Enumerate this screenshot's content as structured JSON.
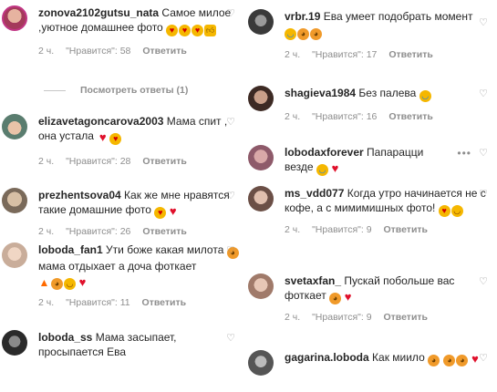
{
  "colors": {
    "text": "#262626",
    "muted": "#8e8e8e",
    "heart": "#e0102b"
  },
  "icons": {
    "like": "heart-outline-icon",
    "more": "more-options-icon"
  },
  "left": [
    {
      "id": "c1",
      "username": "zonova2102gutsu_nata",
      "text": "Самое милое ,уютное домашнее фото",
      "emojis": [
        "heart-eyes",
        "heart-eyes",
        "heart-eyes",
        "thumbs-up"
      ],
      "time": "2 ч.",
      "likes": "\"Нравится\": 58",
      "reply": "Ответить",
      "view_replies": "Посмотреть ответы (1)"
    },
    {
      "id": "c2",
      "username": "elizavetagoncarova2003",
      "text": "Мама спит , она устала",
      "emojis": [
        "heart",
        "heart-eyes"
      ],
      "time": "2 ч.",
      "likes": "\"Нравится\": 28",
      "reply": "Ответить"
    },
    {
      "id": "c3",
      "username": "prezhentsova04",
      "text": "Как же мне нравятся такие домашние фото",
      "emojis": [
        "heart-eyes",
        "heart"
      ],
      "time": "2 ч.",
      "likes": "\"Нравится\": 26",
      "reply": "Ответить"
    },
    {
      "id": "c4",
      "username": "loboda_fan1",
      "text_a": "Ути боже какая милота",
      "text_b": "мама отдыхает а доча фоткает",
      "emojis_a": [
        "cat"
      ],
      "emojis_b": [
        "fire",
        "laugh-cat",
        "smile",
        "heart"
      ],
      "time": "2 ч.",
      "likes": "\"Нравится\": 11",
      "reply": "Ответить"
    },
    {
      "id": "c5",
      "username": "loboda_ss",
      "text": "Мама засыпает, просыпается Ева",
      "emojis": []
    }
  ],
  "right": [
    {
      "id": "r1",
      "username": "vrbr.19",
      "text": "Ева умеет подобрать момент",
      "emojis": [
        "laugh",
        "cat",
        "cat"
      ],
      "time": "2 ч.",
      "likes": "\"Нравится\": 17",
      "reply": "Ответить"
    },
    {
      "id": "r2",
      "username": "shagieva1984",
      "text": "Без палева",
      "emojis": [
        "laugh"
      ],
      "time": "2 ч.",
      "likes": "\"Нравится\": 16",
      "reply": "Ответить"
    },
    {
      "id": "r3",
      "username": "lobodaxforever",
      "text": "Папарацци везде",
      "emojis": [
        "laugh",
        "heart"
      ],
      "more": "•••"
    },
    {
      "id": "r4",
      "username": "ms_vdd077",
      "text": "Когда утро начинается не с кофе, а с мимимишных фото!",
      "emojis": [
        "heart-eyes",
        "smile"
      ],
      "time": "2 ч.",
      "likes": "\"Нравится\": 9",
      "reply": "Ответить"
    },
    {
      "id": "r5",
      "username": "svetaxfan_",
      "text": "Пускай побольше вас фоткает",
      "emojis": [
        "laugh-cat",
        "heart"
      ],
      "time": "2 ч.",
      "likes": "\"Нравится\": 9",
      "reply": "Ответить"
    },
    {
      "id": "r6",
      "username": "gagarina.loboda",
      "text": "Как миило",
      "emojis_a": [
        "cat"
      ],
      "emojis_b": [
        "cat",
        "cat",
        "heart"
      ]
    }
  ]
}
